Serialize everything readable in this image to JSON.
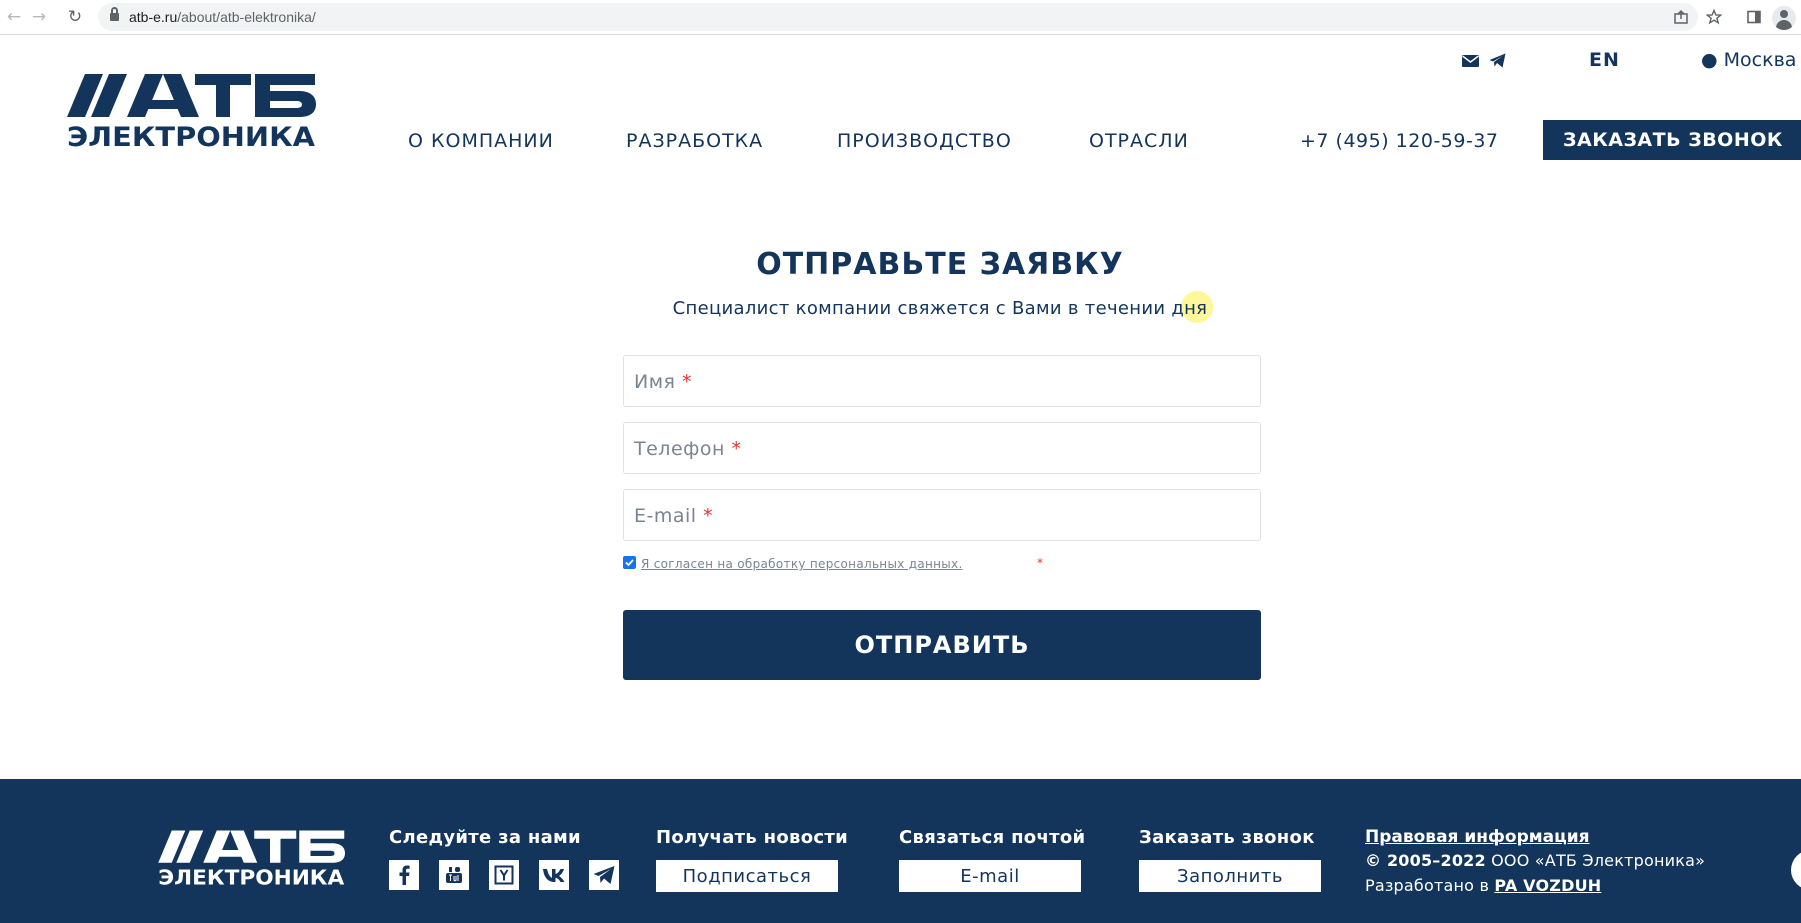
{
  "browser": {
    "url_host": "atb-e.ru",
    "url_path": "/about/atb-elektronika/"
  },
  "header": {
    "lang": "EN",
    "city": "Москва",
    "nav": [
      "О КОМПАНИИ",
      "РАЗРАБОТКА",
      "ПРОИЗВОДСТВО",
      "ОТРАСЛИ"
    ],
    "phone": "+7 (495) 120-59-37",
    "callback_label": "ЗАКАЗАТЬ ЗВОНОК"
  },
  "form": {
    "title": "ОТПРАВЬТЕ ЗАЯВКУ",
    "subtitle": "Специалист компании свяжется с Вами в течении дня",
    "name_placeholder": "Имя",
    "phone_placeholder": "Телефон",
    "email_placeholder": "E-mail",
    "required_mark": "*",
    "consent_label": "Я согласен на обработку персональных данных.",
    "consent_checked": true,
    "submit_label": "ОТПРАВИТЬ"
  },
  "footer": {
    "follow_heading": "Следуйте за нами",
    "news_heading": "Получать новости",
    "news_button": "Подписаться",
    "mail_heading": "Связаться почтой",
    "mail_button": "E-mail",
    "call_heading": "Заказать звонок",
    "call_button": "Заполнить",
    "legal_link": "Правовая информация",
    "copyright_years": "© 2005–2022",
    "copyright_company": "ООО «АТБ Электроника»",
    "developed_by_prefix": "Разработано в",
    "developed_by_link": "PA VOZDUH"
  },
  "icons": {
    "back": "arrow-left-icon",
    "forward": "arrow-right-icon",
    "reload": "reload-icon",
    "share": "share-icon",
    "bookmark": "star-icon",
    "side_panel": "side-panel-icon",
    "mail": "envelope-icon",
    "telegram": "telegram-icon",
    "location": "map-pin-icon",
    "social": [
      "facebook-icon",
      "youtube-icon",
      "yandex-icon",
      "vk-icon",
      "telegram-icon"
    ]
  },
  "colors": {
    "brand_navy": "#13345b",
    "required_red": "#e3342f",
    "placeholder_gray": "#7a8593",
    "field_border": "#dfe3e8",
    "cursor_highlight": "#fff046"
  }
}
